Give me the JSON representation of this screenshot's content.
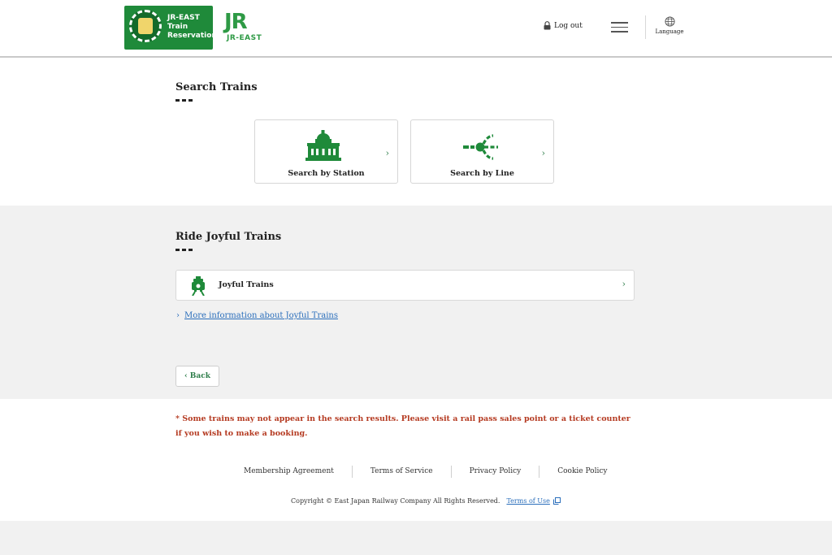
{
  "header": {
    "logo_text_line1": "JR-EAST",
    "logo_text_line2": "Train",
    "logo_text_line3": "Reservation",
    "jr_logo_main": "JR",
    "jr_logo_sub": "JR-EAST",
    "logout_label": "Log out",
    "language_label": "Language"
  },
  "search": {
    "title": "Search Trains",
    "cards": [
      {
        "label": "Search by Station",
        "icon": "station-building-icon"
      },
      {
        "label": "Search by Line",
        "icon": "line-branch-icon"
      }
    ]
  },
  "joyful": {
    "title": "Ride Joyful Trains",
    "card_label": "Joyful Trains",
    "more_link": "More information about Joyful Trains",
    "back_label": "Back"
  },
  "footer": {
    "notice": "* Some trains may not appear in the search results. Please visit a rail pass sales point or a ticket counter if you wish to make a booking.",
    "links": [
      "Membership Agreement",
      "Terms of Service",
      "Privacy Policy",
      "Cookie Policy"
    ],
    "copyright": "Copyright © East Japan Railway Company All Rights Reserved.",
    "terms_of_use": "Terms of Use"
  },
  "colors": {
    "brand_green": "#1f8a3a",
    "jr_green": "#2e9a45",
    "link_blue": "#2a6ebb",
    "notice_red": "#b53b22"
  }
}
